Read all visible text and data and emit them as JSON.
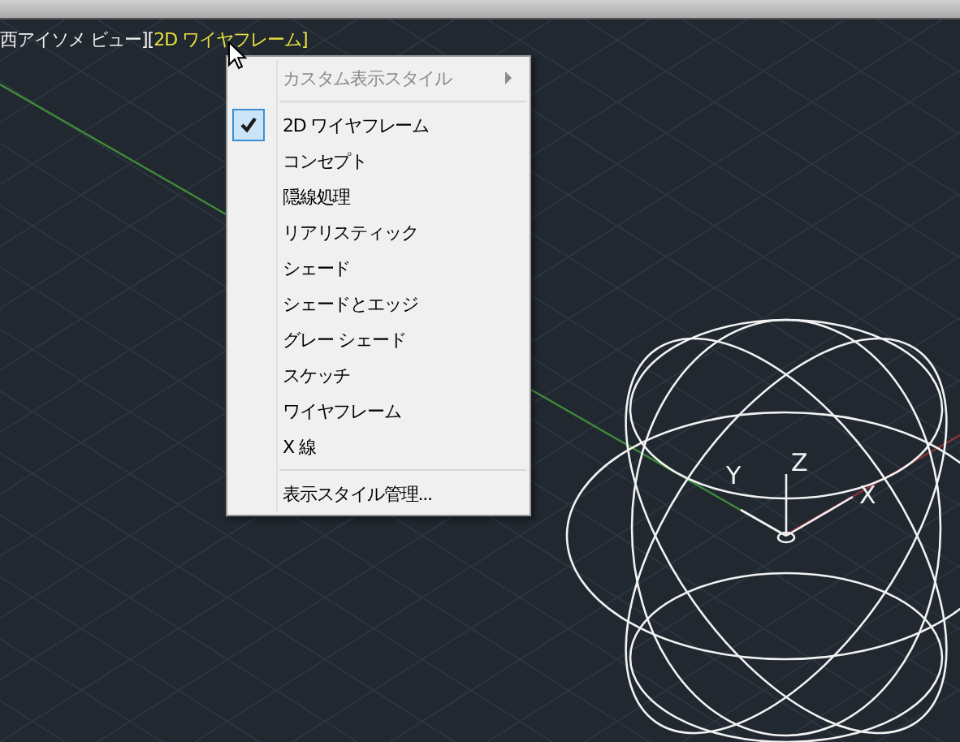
{
  "viewport_label": {
    "view": "西アイソメ ビュー][",
    "style": "2D ワイヤフレーム]"
  },
  "ucs_axes": [
    "X",
    "Y",
    "Z"
  ],
  "context_menu": {
    "header": {
      "label": "カスタム表示スタイル",
      "disabled": true
    },
    "items": [
      {
        "label": "2D ワイヤフレーム",
        "selected": true
      },
      {
        "label": "コンセプト",
        "selected": false
      },
      {
        "label": "隠線処理",
        "selected": false
      },
      {
        "label": "リアリスティック",
        "selected": false
      },
      {
        "label": "シェード",
        "selected": false
      },
      {
        "label": "シェードとエッジ",
        "selected": false
      },
      {
        "label": "グレー シェード",
        "selected": false
      },
      {
        "label": "スケッチ",
        "selected": false
      },
      {
        "label": "ワイヤフレーム",
        "selected": false
      },
      {
        "label": "X 線",
        "selected": false
      }
    ],
    "footer": "表示スタイル管理..."
  }
}
